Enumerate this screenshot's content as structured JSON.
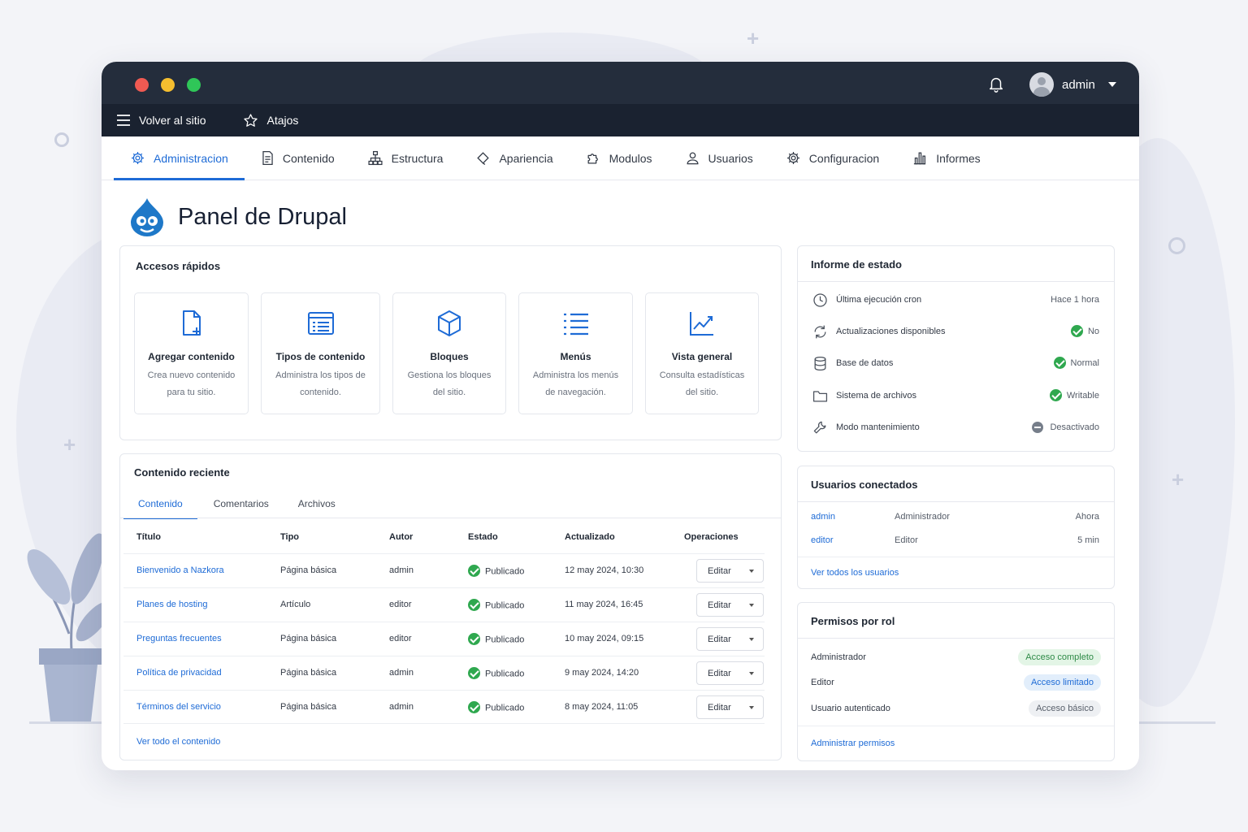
{
  "app": {
    "user_name": "admin",
    "toolbar": {
      "back_label": "Volver al sitio",
      "shortcuts_label": "Atajos"
    },
    "window_dots": {
      "red": "#f05a52",
      "yellow": "#f5be2f",
      "green": "#2fc658"
    },
    "accent_color": "#1e6bd6"
  },
  "nav": {
    "tabs": [
      {
        "label": "Administracion",
        "icon": "gear-icon",
        "active": true
      },
      {
        "label": "Contenido",
        "icon": "document-icon"
      },
      {
        "label": "Estructura",
        "icon": "sitemap-icon"
      },
      {
        "label": "Apariencia",
        "icon": "paint-icon"
      },
      {
        "label": "Modulos",
        "icon": "puzzle-icon"
      },
      {
        "label": "Usuarios",
        "icon": "user-icon"
      },
      {
        "label": "Configuracion",
        "icon": "gear-icon"
      },
      {
        "label": "Informes",
        "icon": "bar-chart-icon"
      }
    ]
  },
  "page": {
    "title": "Panel de Drupal"
  },
  "quick_access": {
    "title": "Accesos rápidos",
    "items": [
      {
        "title": "Agregar contenido",
        "desc1": "Crea nuevo contenido",
        "desc2": "para tu sitio.",
        "icon": "file-plus-icon"
      },
      {
        "title": "Tipos de contenido",
        "desc1": "Administra los tipos de",
        "desc2": "contenido.",
        "icon": "list-window-icon"
      },
      {
        "title": "Bloques",
        "desc1": "Gestiona los bloques",
        "desc2": "del sitio.",
        "icon": "cube-icon"
      },
      {
        "title": "Menús",
        "desc1": "Administra los menús",
        "desc2": "de navegación.",
        "icon": "menu-list-icon"
      },
      {
        "title": "Vista general",
        "desc1": "Consulta estadísticas",
        "desc2": "del sitio.",
        "icon": "line-chart-icon"
      }
    ]
  },
  "recent": {
    "title": "Contenido reciente",
    "tabs": [
      "Contenido",
      "Comentarios",
      "Archivos"
    ],
    "columns": [
      "Título",
      "Tipo",
      "Autor",
      "Estado",
      "Actualizado",
      "Operaciones"
    ],
    "rows": [
      {
        "title": "Bienvenido a Nazkora",
        "type": "Página básica",
        "author": "admin",
        "status": "Publicado",
        "updated": "12 may 2024, 10:30",
        "op": "Editar"
      },
      {
        "title": "Planes de hosting",
        "type": "Artículo",
        "author": "editor",
        "status": "Publicado",
        "updated": "11 may 2024, 16:45",
        "op": "Editar"
      },
      {
        "title": "Preguntas frecuentes",
        "type": "Página básica",
        "author": "editor",
        "status": "Publicado",
        "updated": "10 may 2024, 09:15",
        "op": "Editar"
      },
      {
        "title": "Política de privacidad",
        "type": "Página básica",
        "author": "admin",
        "status": "Publicado",
        "updated": "9 may 2024, 14:20",
        "op": "Editar"
      },
      {
        "title": "Términos del servicio",
        "type": "Página básica",
        "author": "admin",
        "status": "Publicado",
        "updated": "8 may 2024, 11:05",
        "op": "Editar"
      }
    ],
    "view_all": "Ver todo el contenido"
  },
  "status_report": {
    "title": "Informe de estado",
    "rows": [
      {
        "label": "Última ejecución cron",
        "value": "Hace 1 hora",
        "icon": "clock-icon",
        "state": "none"
      },
      {
        "label": "Actualizaciones disponibles",
        "value": "No",
        "icon": "refresh-icon",
        "state": "ok"
      },
      {
        "label": "Base de datos",
        "value": "Normal",
        "icon": "database-icon",
        "state": "ok"
      },
      {
        "label": "Sistema de archivos",
        "value": "Writable",
        "icon": "folder-icon",
        "state": "ok"
      },
      {
        "label": "Modo mantenimiento",
        "value": "Desactivado",
        "icon": "wrench-icon",
        "state": "off"
      }
    ]
  },
  "online_users": {
    "title": "Usuarios conectados",
    "rows": [
      {
        "name": "admin",
        "role": "Administrador",
        "time": "Ahora"
      },
      {
        "name": "editor",
        "role": "Editor",
        "time": "5 min"
      }
    ],
    "view_all": "Ver todos los usuarios"
  },
  "permissions": {
    "title": "Permisos por rol",
    "rows": [
      {
        "role": "Administrador",
        "access": "Acceso completo",
        "bg": "#e3f5e6",
        "fg": "#2e8a47"
      },
      {
        "role": "Editor",
        "access": "Acceso limitado",
        "bg": "#e2eefb",
        "fg": "#1e6bd6"
      },
      {
        "role": "Usuario autenticado",
        "access": "Acceso básico",
        "bg": "#eef0f3",
        "fg": "#5a616c"
      }
    ],
    "manage": "Administrar permisos"
  }
}
